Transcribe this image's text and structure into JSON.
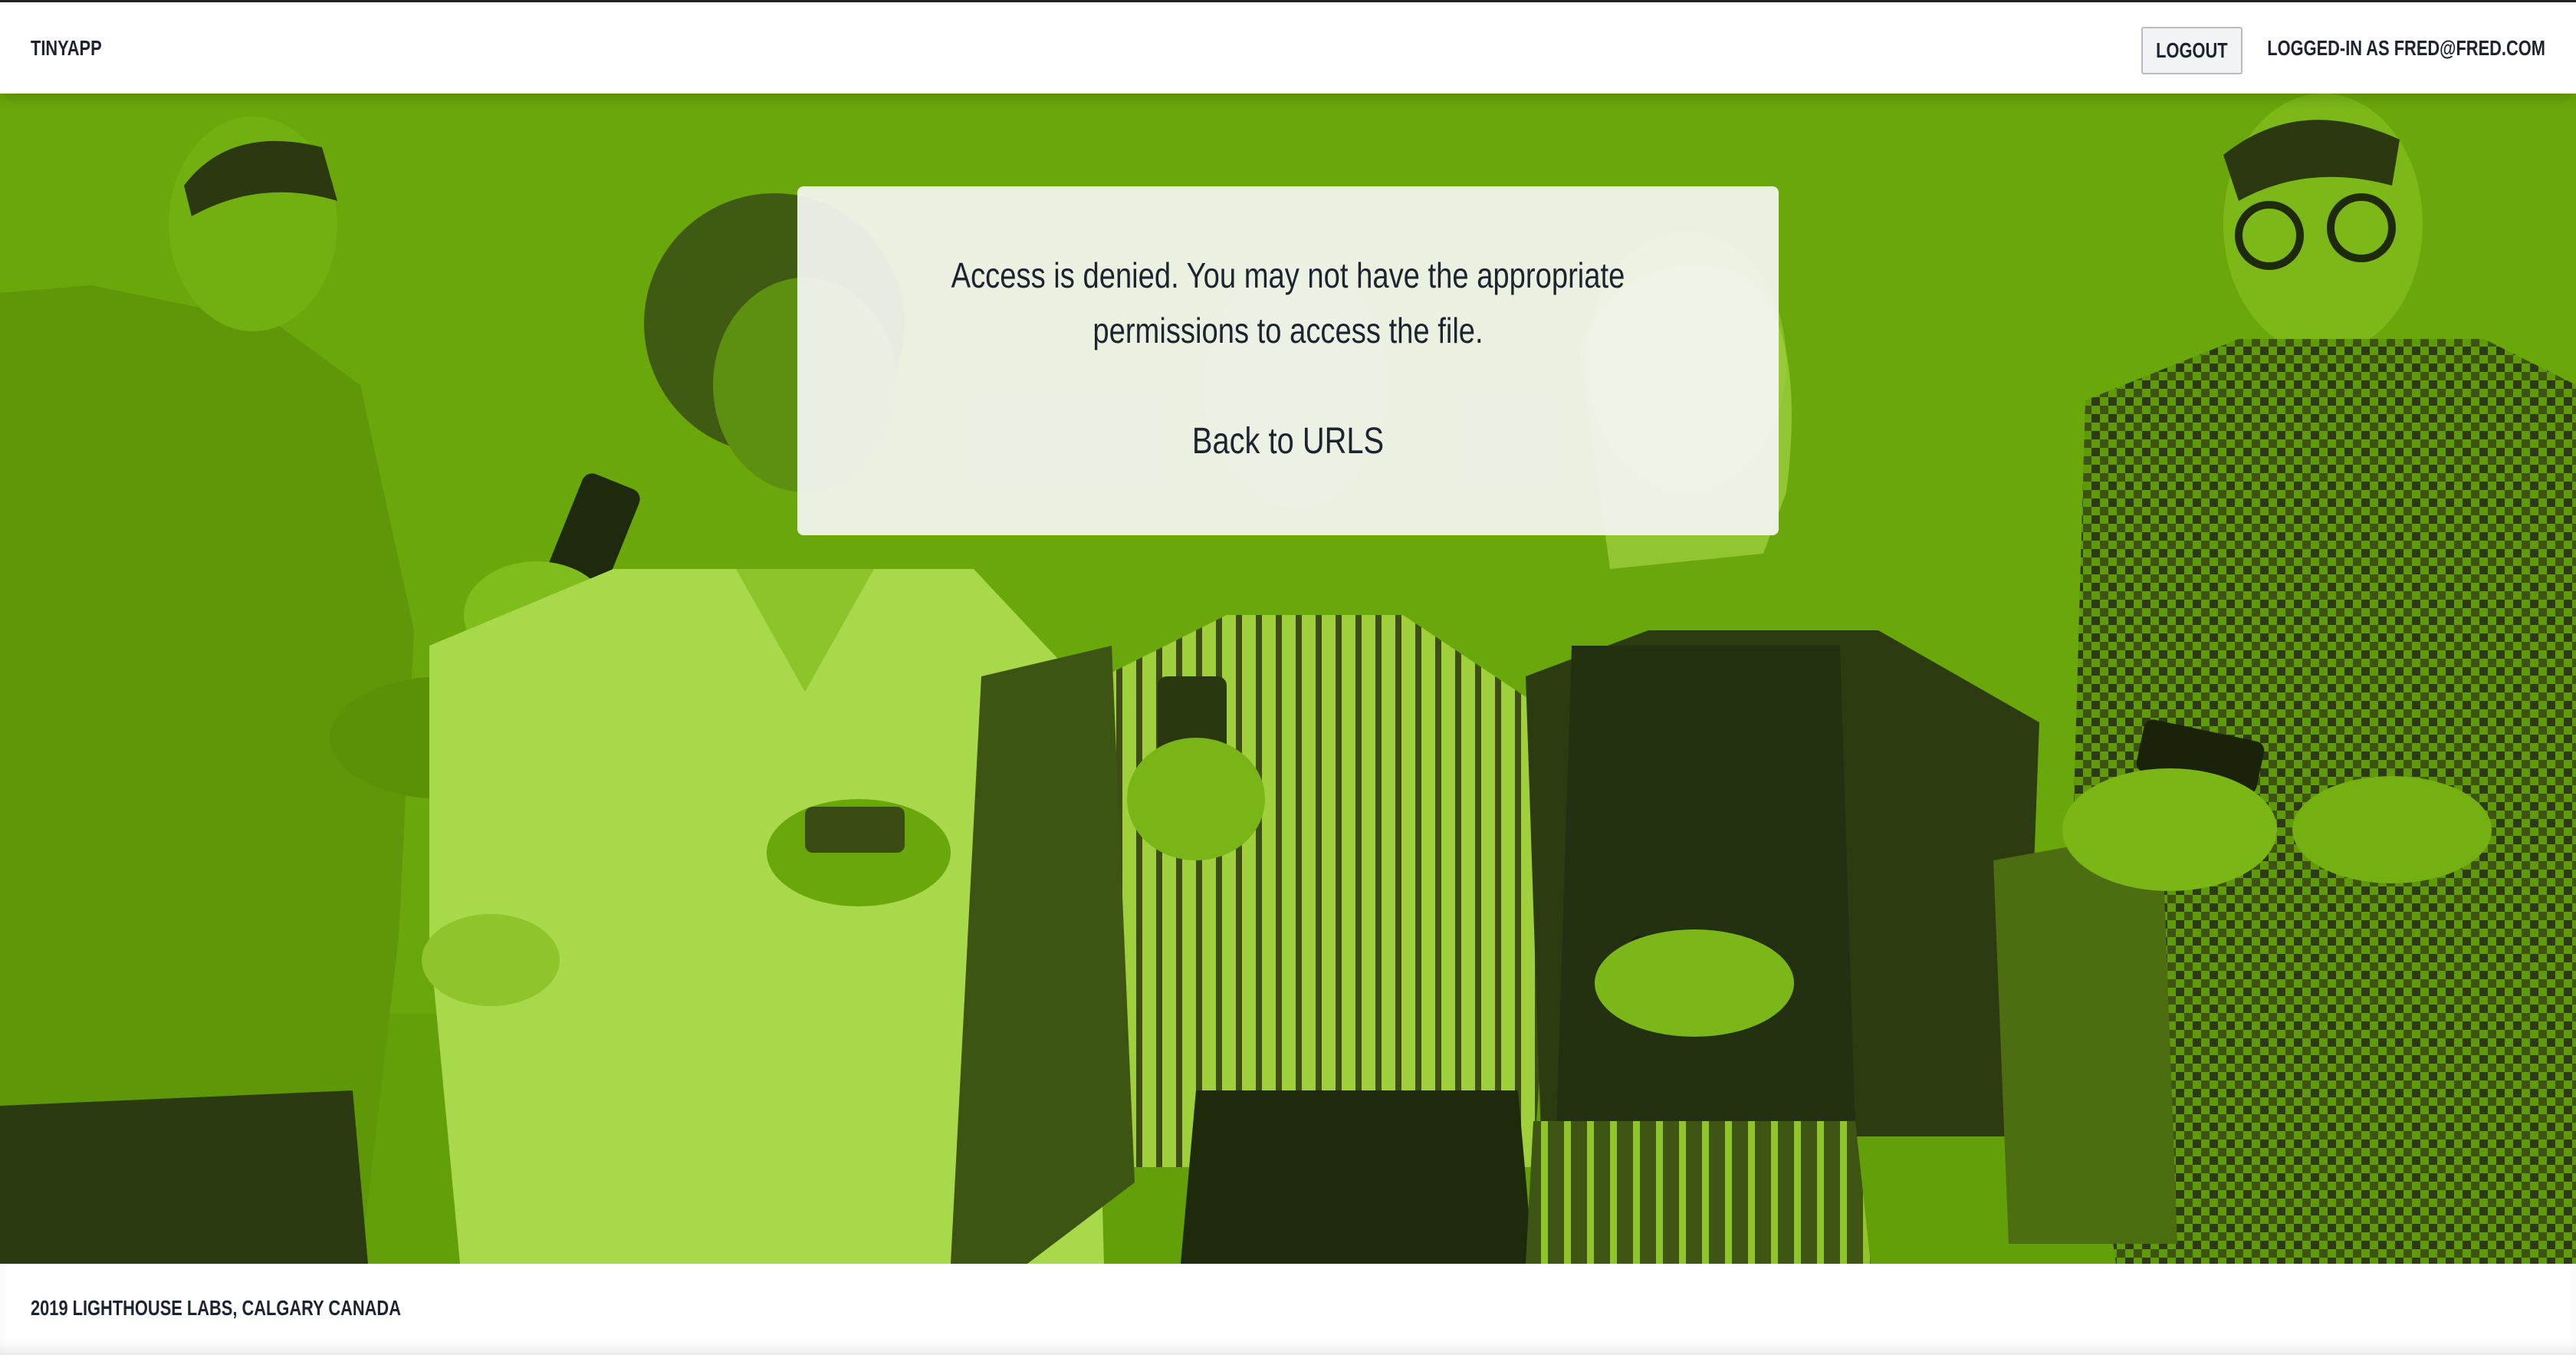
{
  "header": {
    "brand": "TINYAPP",
    "logout_label": "LOGOUT",
    "logged_in_text": "LOGGED-IN AS FRED@FRED.COM"
  },
  "message": {
    "text": "Access is denied. You may not have the appropriate permissions to access the file.",
    "back_link": "Back to URLS"
  },
  "footer": {
    "text": "2019 LIGHTHOUSE LABS, CALGARY CANADA"
  },
  "colors": {
    "hero_tint": "#6aa70a",
    "text": "#1d2430",
    "card": "#f4f6f2"
  }
}
